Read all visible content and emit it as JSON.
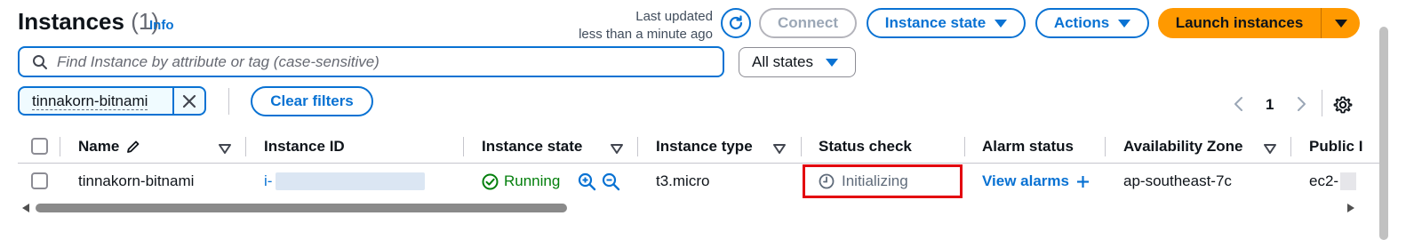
{
  "header": {
    "title": "Instances",
    "count": "(1)",
    "info_link": "Info",
    "last_updated_line1": "Last updated",
    "last_updated_line2": "less than a minute ago",
    "connect_label": "Connect",
    "instance_state_label": "Instance state",
    "actions_label": "Actions",
    "launch_label": "Launch instances"
  },
  "search": {
    "placeholder": "Find Instance by attribute or tag (case-sensitive)",
    "state_filter": "All states"
  },
  "filters": {
    "token": "tinnakorn-bitnami",
    "clear_label": "Clear filters"
  },
  "pagination": {
    "current_page": "1"
  },
  "table": {
    "columns": [
      "Name",
      "Instance ID",
      "Instance state",
      "Instance type",
      "Status check",
      "Alarm status",
      "Availability Zone",
      "Public I"
    ],
    "rows": [
      {
        "name": "tinnakorn-bitnami",
        "instance_id_prefix": "i-",
        "instance_state": "Running",
        "instance_type": "t3.micro",
        "status_check": "Initializing",
        "alarm_status": "View alarms",
        "availability_zone": "ap-southeast-7c",
        "public_dns_prefix": "ec2-"
      }
    ]
  },
  "colors": {
    "accent": "#0972d3",
    "launch": "#ff9900",
    "running": "#037f0c",
    "highlight_box": "#e3000f"
  }
}
